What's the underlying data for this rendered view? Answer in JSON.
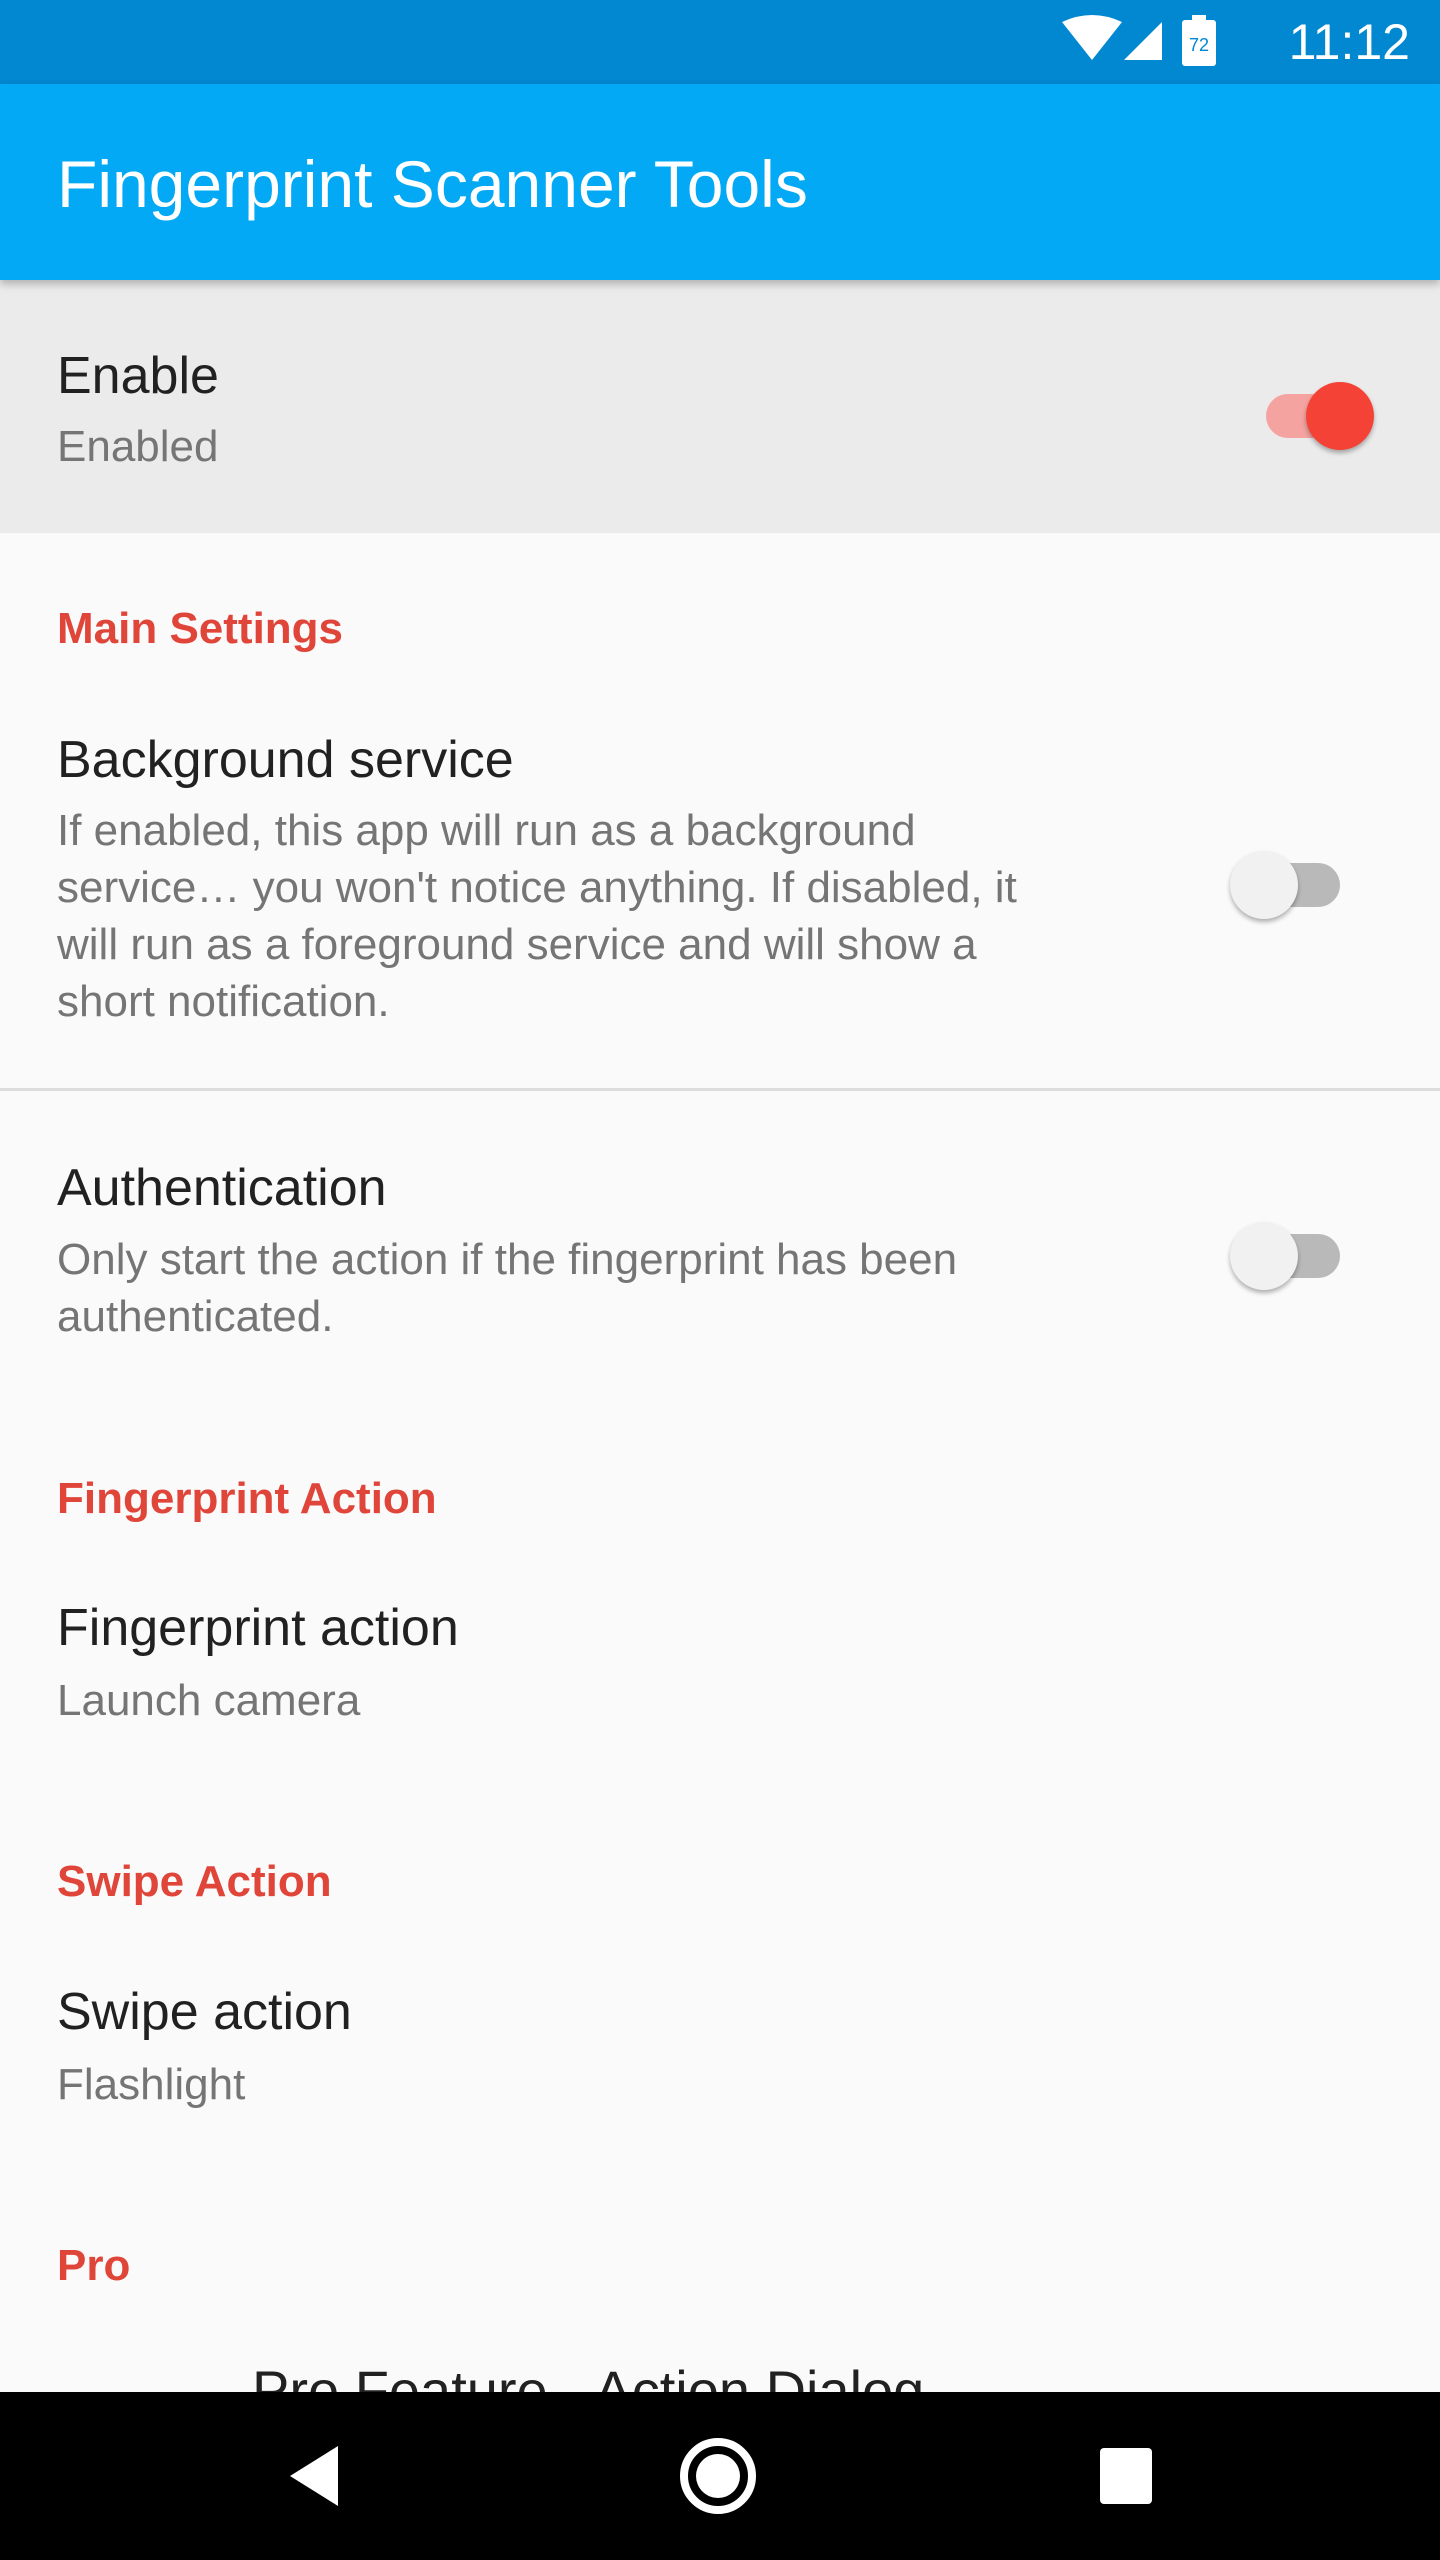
{
  "status_bar": {
    "time": "11:12",
    "battery_level": "72",
    "icons": [
      "wifi-icon",
      "signal-icon",
      "battery-icon"
    ]
  },
  "app_bar": {
    "title": "Fingerprint Scanner Tools"
  },
  "enable": {
    "title": "Enable",
    "summary": "Enabled",
    "checked": true
  },
  "sections": {
    "main_settings": "Main Settings",
    "fingerprint_action": "Fingerprint Action",
    "swipe_action": "Swipe Action",
    "pro": "Pro"
  },
  "background_service": {
    "title": "Background service",
    "summary_lines": [
      "If enabled, this app will run as a background",
      "service… you won't notice anything. If disabled, it",
      "will run as a foreground service and will show a",
      "short notification."
    ],
    "checked": false
  },
  "authentication": {
    "title": "Authentication",
    "summary_lines": [
      "Only start the action if the fingerprint has been",
      "authenticated."
    ],
    "checked": false
  },
  "fingerprint_action": {
    "title": "Fingerprint action",
    "summary": "Launch camera"
  },
  "swipe_action": {
    "title": "Swipe action",
    "summary": "Flashlight"
  },
  "pro_item": {
    "title": "Pro Feature - Action Dialog"
  },
  "colors": {
    "status_bar": "#0288d1",
    "app_bar": "#03a9f4",
    "accent": "#f44336",
    "section_header": "#e0453a"
  },
  "nav_bar": {
    "icons": [
      "back-icon",
      "home-icon",
      "recents-icon"
    ]
  }
}
